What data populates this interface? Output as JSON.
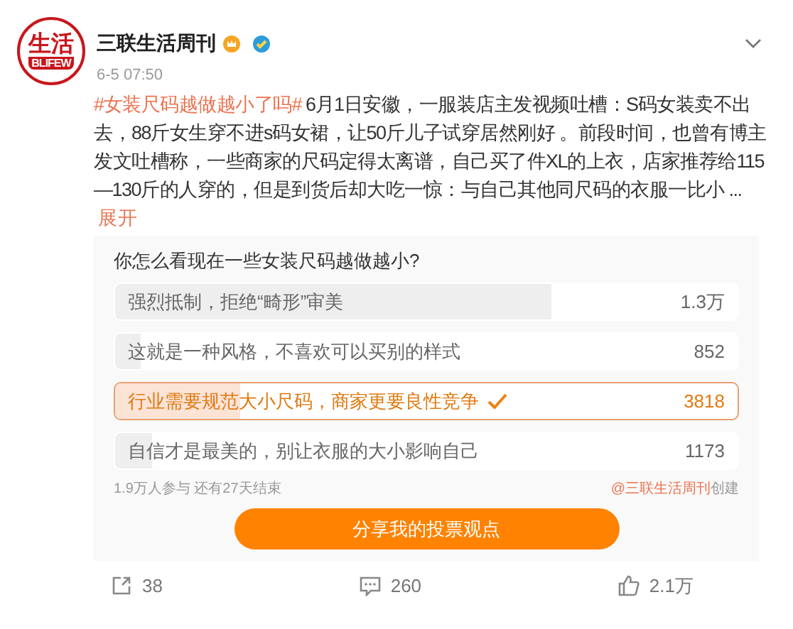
{
  "post": {
    "author": "三联生活周刊",
    "avatar_text": "生活",
    "avatar_subtext": "BLIFEW",
    "time": "6-5 07:50",
    "hashtag": "#女装尺码越做越小了吗#",
    "text": "6月1日安徽，一服装店主发视频吐槽：S码女装卖不出去，88斤女生穿不进s码女裙，让50斤儿子试穿居然刚好 。前段时间，也曾有博主发文吐槽称，一些商家的尺码定得太离谱，自己买了件XL的上衣，店家推荐给115—130斤的人穿的，但是到货后却大吃一惊：与自己其他同尺码的衣服一比小 ...",
    "expand": "展开"
  },
  "poll": {
    "question": "你怎么看现在一些女装尺码越做越小?",
    "options": [
      {
        "label": "强烈抵制，拒绝“畸形”审美",
        "count": "1.3万",
        "level": 0.7,
        "selected": false
      },
      {
        "label": "这就是一种风格，不喜欢可以买别的样式",
        "count": "852",
        "level": 0.04,
        "selected": false
      },
      {
        "label": "行业需要规范大小尺码，商家更要良性竞争",
        "count": "3818",
        "level": 0.2,
        "selected": true
      },
      {
        "label": "自信才是最美的，别让衣服的大小影响自己",
        "count": "1173",
        "level": 0.06,
        "selected": false
      }
    ],
    "participants": "1.9万人参与 还有27天结束",
    "creator": "@三联生活周刊",
    "created": "创建",
    "share_button": "分享我的投票观点"
  },
  "actions": {
    "reposts": "38",
    "comments": "260",
    "likes": "2.1万"
  }
}
